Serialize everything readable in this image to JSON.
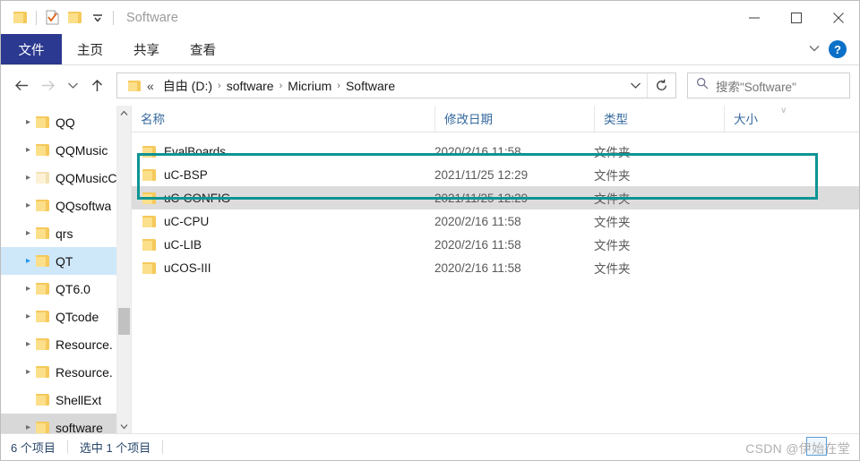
{
  "window": {
    "title": "Software",
    "controls": {
      "minimize": "—",
      "maximize": "□",
      "close": "✕",
      "ribbon_chevron": "∨",
      "help": "?"
    }
  },
  "quick_access": {
    "items": [
      {
        "icon": "folder-icon",
        "name": "folder"
      },
      {
        "icon": "properties-icon",
        "name": "properties"
      },
      {
        "icon": "folder-icon",
        "name": "new-folder"
      },
      {
        "icon": "chevron-down-icon",
        "name": "customize-dropdown"
      }
    ]
  },
  "ribbon": {
    "tabs": [
      {
        "label": "文件",
        "active": true
      },
      {
        "label": "主页",
        "active": false
      },
      {
        "label": "共享",
        "active": false
      },
      {
        "label": "查看",
        "active": false
      }
    ]
  },
  "address_bar": {
    "back": "←",
    "forward": "→",
    "recent": "∨",
    "up": "↑",
    "breadcrumb_separator": "›",
    "root_prefix": "«",
    "crumbs": [
      "自由 (D:)",
      "software",
      "Micrium",
      "Software"
    ],
    "dropdown": "∨",
    "refresh": "↻"
  },
  "search": {
    "icon": "search-icon",
    "placeholder": "搜索\"Software\""
  },
  "sidebar": {
    "items": [
      {
        "label": "QQ",
        "expandable": true,
        "state": "none"
      },
      {
        "label": "QQMusic",
        "expandable": true,
        "state": "none"
      },
      {
        "label": "QQMusicC",
        "expandable": true,
        "state": "none",
        "pale": true
      },
      {
        "label": "QQsoftwa",
        "expandable": true,
        "state": "none"
      },
      {
        "label": "qrs",
        "expandable": true,
        "state": "none"
      },
      {
        "label": "QT",
        "expandable": true,
        "state": "selected-blue"
      },
      {
        "label": "QT6.0",
        "expandable": true,
        "state": "none"
      },
      {
        "label": "QTcode",
        "expandable": true,
        "state": "none"
      },
      {
        "label": "Resource.",
        "expandable": true,
        "state": "none"
      },
      {
        "label": "Resource.",
        "expandable": true,
        "state": "none"
      },
      {
        "label": "ShellExt",
        "expandable": false,
        "state": "none"
      },
      {
        "label": "software",
        "expandable": true,
        "state": "selected-gray"
      }
    ],
    "scrollbar": {
      "up": "∧",
      "down": "∨"
    }
  },
  "file_list": {
    "columns": [
      {
        "label": "名称",
        "key": "name"
      },
      {
        "label": "修改日期",
        "key": "date"
      },
      {
        "label": "类型",
        "key": "type"
      },
      {
        "label": "大小",
        "key": "size"
      }
    ],
    "sort_indicator": "∨",
    "rows": [
      {
        "name": "EvalBoards",
        "date": "2020/2/16 11:58",
        "type": "文件夹",
        "size": "",
        "selected": false
      },
      {
        "name": "uC-BSP",
        "date": "2021/11/25 12:29",
        "type": "文件夹",
        "size": "",
        "selected": false
      },
      {
        "name": "uC-CONFIG",
        "date": "2021/11/25 12:29",
        "type": "文件夹",
        "size": "",
        "selected": true
      },
      {
        "name": "uC-CPU",
        "date": "2020/2/16 11:58",
        "type": "文件夹",
        "size": "",
        "selected": false
      },
      {
        "name": "uC-LIB",
        "date": "2020/2/16 11:58",
        "type": "文件夹",
        "size": "",
        "selected": false
      },
      {
        "name": "uCOS-III",
        "date": "2020/2/16 11:58",
        "type": "文件夹",
        "size": "",
        "selected": false
      }
    ]
  },
  "annotation": {
    "color": "#0d9494",
    "covers": [
      "uC-BSP",
      "uC-CONFIG"
    ]
  },
  "status_bar": {
    "item_count": "6 个项目",
    "selection": "选中 1 个项目"
  },
  "watermark": {
    "text": "CSDN @伊始在堂"
  }
}
